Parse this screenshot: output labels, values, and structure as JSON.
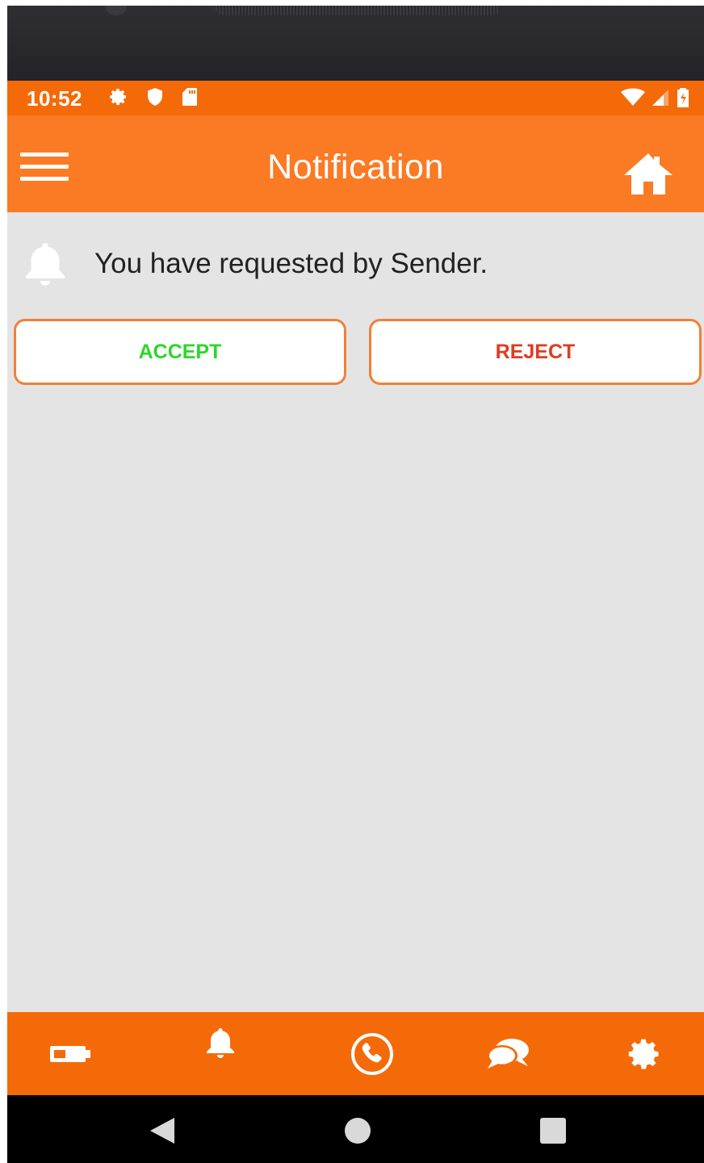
{
  "status_bar": {
    "time": "10:52",
    "left_icons": [
      "settings-icon",
      "shield-icon",
      "sd-card-icon"
    ],
    "right_icons": [
      "wifi-icon",
      "signal-icon",
      "battery-icon"
    ]
  },
  "app_bar": {
    "title": "Notification",
    "menu_icon": "hamburger-menu-icon",
    "home_icon": "home-icon"
  },
  "notification": {
    "icon": "bell-icon",
    "message": "You have requested by Sender."
  },
  "actions": {
    "accept_label": "ACCEPT",
    "reject_label": "REJECT"
  },
  "bottom_nav": {
    "items": [
      "battery-icon",
      "bell-icon",
      "phone-icon",
      "chat-icon",
      "settings-icon"
    ]
  },
  "system_nav": {
    "items": [
      "back-icon",
      "home-circle-icon",
      "recents-icon"
    ]
  },
  "colors": {
    "status_bar": "#f46a09",
    "app_bar": "#fb7a24",
    "content_bg": "#e5e4e5",
    "button_border": "#f08037",
    "accept_text": "#2ed62b",
    "reject_text": "#e03a20"
  }
}
